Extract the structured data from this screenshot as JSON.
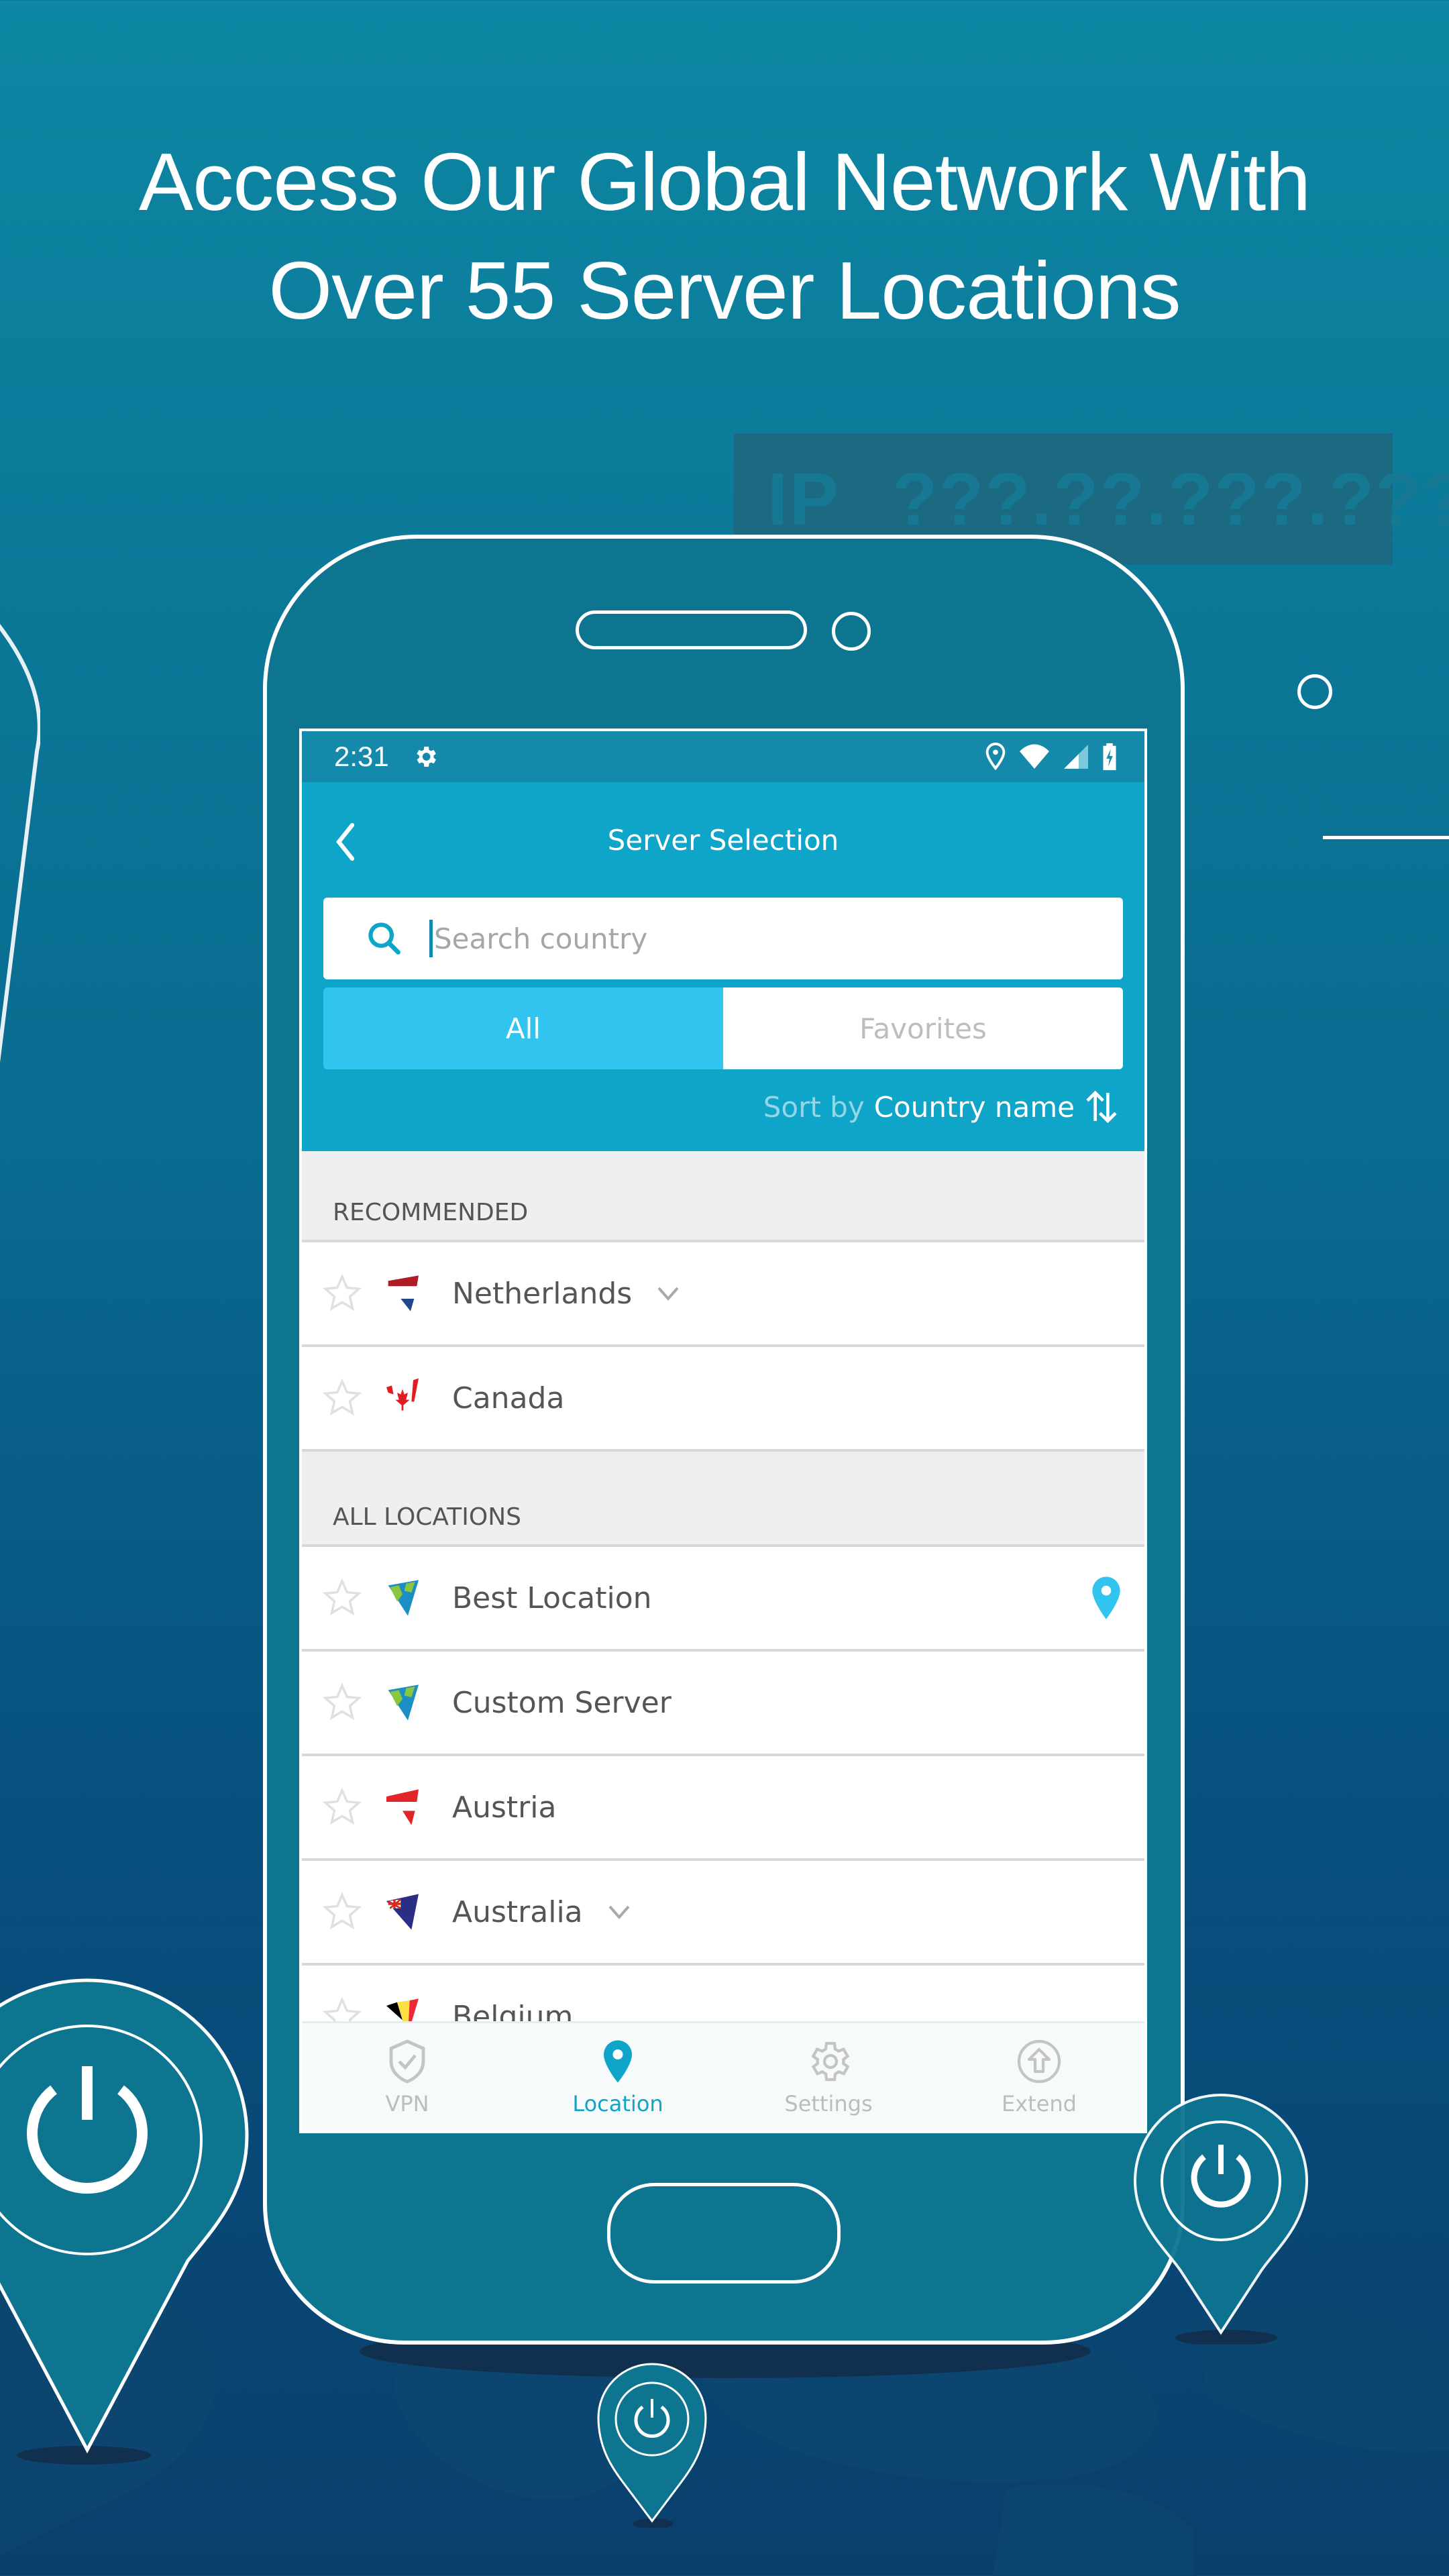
{
  "headline": {
    "line1": "Access Our Global Network With",
    "line2": "Over 55 Server Locations"
  },
  "ip_banner": {
    "label": "IP",
    "value": "???.??.???.???"
  },
  "status_bar": {
    "time": "2:31",
    "icons": [
      "settings-gear-icon",
      "location-icon",
      "wifi-icon",
      "signal-icon",
      "battery-charging-icon"
    ]
  },
  "app_bar": {
    "title": "Server Selection",
    "back_icon": "chevron-left-icon"
  },
  "search": {
    "placeholder": "Search country",
    "value": ""
  },
  "tabs": [
    {
      "label": "All",
      "active": true
    },
    {
      "label": "Favorites",
      "active": false
    }
  ],
  "sort": {
    "label": "Sort by",
    "value": "Country name",
    "icon": "sort-arrows-icon"
  },
  "sections": [
    {
      "title": "RECOMMENDED",
      "items": [
        {
          "name": "Netherlands",
          "flag": "netherlands-flag-icon",
          "expandable": true,
          "favorite": false
        },
        {
          "name": "Canada",
          "flag": "canada-flag-icon",
          "expandable": false,
          "favorite": false
        }
      ]
    },
    {
      "title": "ALL LOCATIONS",
      "items": [
        {
          "name": "Best Location",
          "flag": "globe-icon",
          "expandable": false,
          "favorite": false,
          "selected": true
        },
        {
          "name": "Custom Server",
          "flag": "globe-icon",
          "expandable": false,
          "favorite": false
        },
        {
          "name": "Austria",
          "flag": "austria-flag-icon",
          "expandable": false,
          "favorite": false
        },
        {
          "name": "Australia",
          "flag": "australia-flag-icon",
          "expandable": true,
          "favorite": false
        },
        {
          "name": "Belgium",
          "flag": "belgium-flag-icon",
          "expandable": false,
          "favorite": false
        }
      ]
    }
  ],
  "bottom_nav": [
    {
      "label": "VPN",
      "icon": "shield-check-icon",
      "active": false
    },
    {
      "label": "Location",
      "icon": "location-pin-icon",
      "active": true
    },
    {
      "label": "Settings",
      "icon": "gear-icon",
      "active": false
    },
    {
      "label": "Extend",
      "icon": "upload-arrow-icon",
      "active": false
    }
  ],
  "colors": {
    "accent": "#0ea5c9",
    "active_tab": "#31c4ef",
    "status_bar": "#1589a9",
    "pin_selected": "#31c4ef"
  }
}
